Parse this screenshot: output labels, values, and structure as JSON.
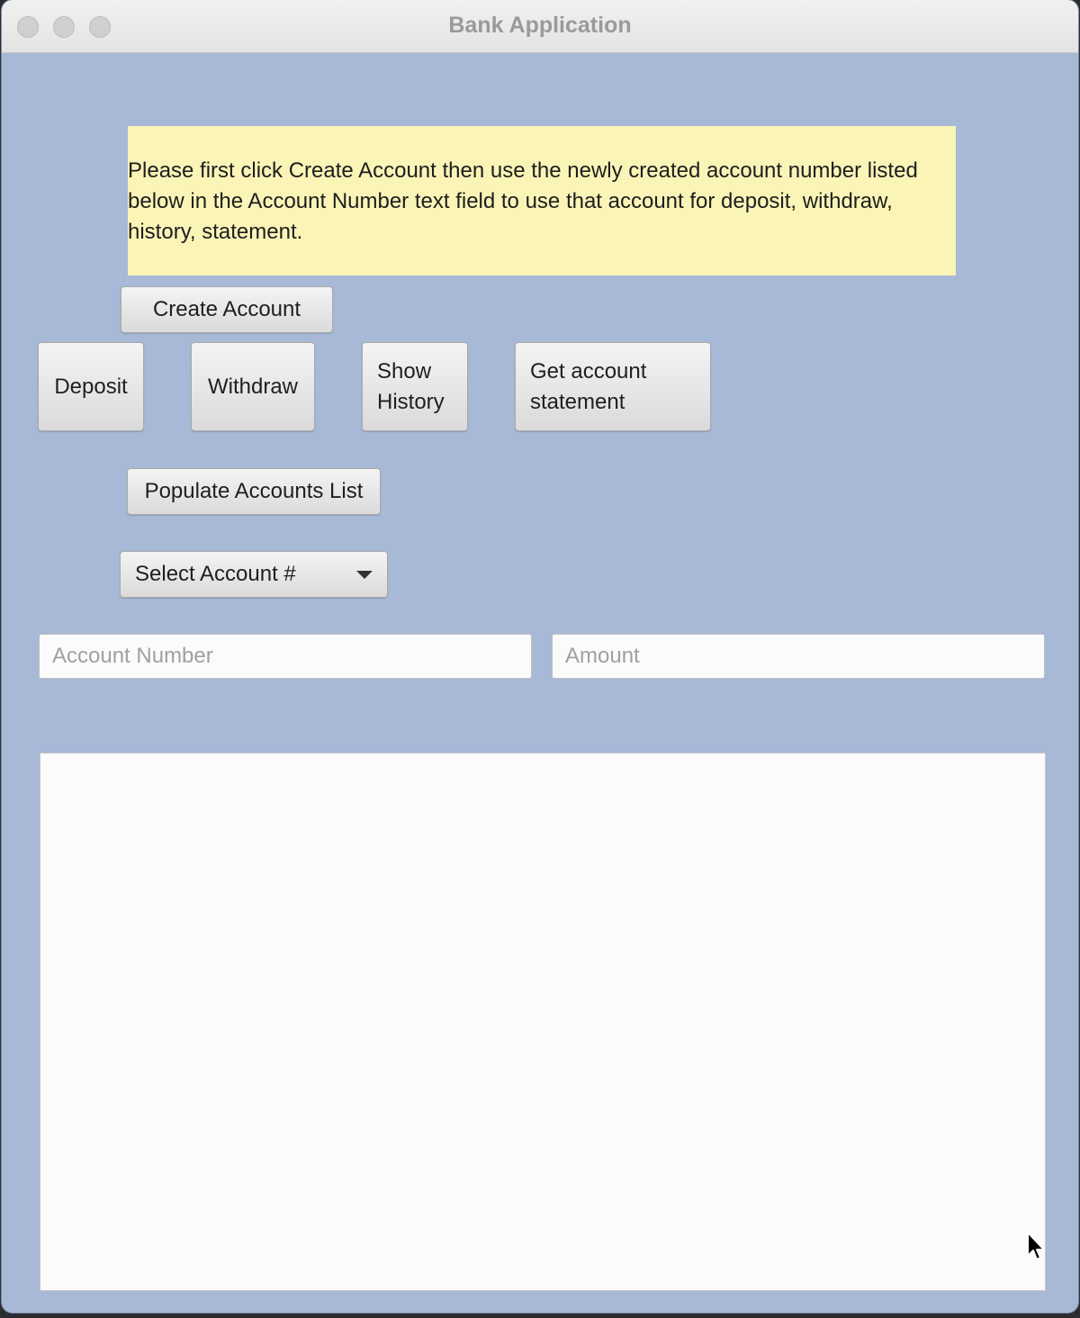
{
  "window": {
    "title": "Bank Application"
  },
  "instructions": "Please first click Create Account then use the newly created account number listed below in the Account Number text field to use that account for deposit, withdraw, history, statement.",
  "buttons": {
    "create_account": "Create Account",
    "deposit": "Deposit",
    "withdraw": "Withdraw",
    "show_history_line1": "Show",
    "show_history_line2": "History",
    "statement_line1": "Get account",
    "statement_line2": "statement",
    "populate": "Populate Accounts List"
  },
  "account_select": {
    "value": "Select Account #"
  },
  "fields": {
    "account_number_placeholder": "Account Number",
    "amount_placeholder": "Amount"
  },
  "output_text": "",
  "colors": {
    "background": "#a7b9d6",
    "note": "#fbf4b7"
  },
  "icons": {
    "dropdown": "chevron-down-icon",
    "cursor": "mouse-pointer-icon"
  }
}
